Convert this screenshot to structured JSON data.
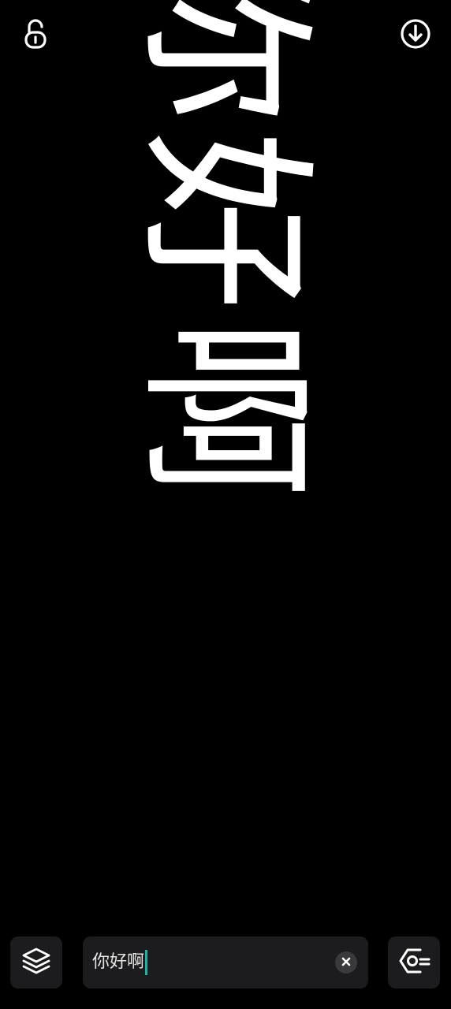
{
  "top_bar": {
    "lock_icon": "unlocked-padlock-icon",
    "download_icon": "download-circle-icon"
  },
  "display": {
    "text": "你好啊",
    "orientation": "rotated-90-clockwise",
    "text_color": "#ffffff",
    "background_color": "#000000"
  },
  "bottom_bar": {
    "layers_icon": "layers-icon",
    "input": {
      "value": "你好啊",
      "caret_color": "#19b5a5"
    },
    "clear_icon": "close-icon",
    "settings_icon": "settings-hexagon-icon"
  }
}
